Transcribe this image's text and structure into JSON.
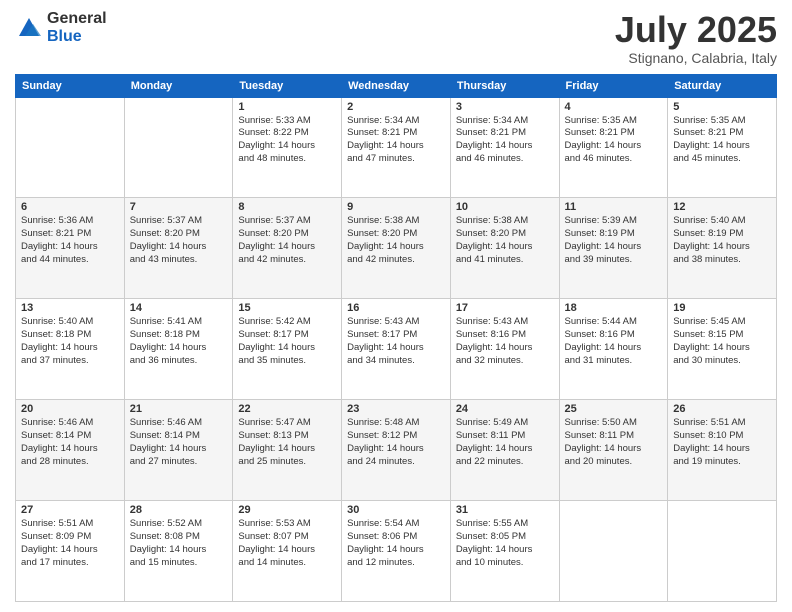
{
  "header": {
    "logo": {
      "general": "General",
      "blue": "Blue"
    },
    "title": "July 2025",
    "location": "Stignano, Calabria, Italy"
  },
  "weekdays": [
    "Sunday",
    "Monday",
    "Tuesday",
    "Wednesday",
    "Thursday",
    "Friday",
    "Saturday"
  ],
  "weeks": [
    [
      {
        "day": "",
        "sunrise": "",
        "sunset": "",
        "daylight": ""
      },
      {
        "day": "",
        "sunrise": "",
        "sunset": "",
        "daylight": ""
      },
      {
        "day": "1",
        "sunrise": "Sunrise: 5:33 AM",
        "sunset": "Sunset: 8:22 PM",
        "daylight": "Daylight: 14 hours and 48 minutes."
      },
      {
        "day": "2",
        "sunrise": "Sunrise: 5:34 AM",
        "sunset": "Sunset: 8:21 PM",
        "daylight": "Daylight: 14 hours and 47 minutes."
      },
      {
        "day": "3",
        "sunrise": "Sunrise: 5:34 AM",
        "sunset": "Sunset: 8:21 PM",
        "daylight": "Daylight: 14 hours and 46 minutes."
      },
      {
        "day": "4",
        "sunrise": "Sunrise: 5:35 AM",
        "sunset": "Sunset: 8:21 PM",
        "daylight": "Daylight: 14 hours and 46 minutes."
      },
      {
        "day": "5",
        "sunrise": "Sunrise: 5:35 AM",
        "sunset": "Sunset: 8:21 PM",
        "daylight": "Daylight: 14 hours and 45 minutes."
      }
    ],
    [
      {
        "day": "6",
        "sunrise": "Sunrise: 5:36 AM",
        "sunset": "Sunset: 8:21 PM",
        "daylight": "Daylight: 14 hours and 44 minutes."
      },
      {
        "day": "7",
        "sunrise": "Sunrise: 5:37 AM",
        "sunset": "Sunset: 8:20 PM",
        "daylight": "Daylight: 14 hours and 43 minutes."
      },
      {
        "day": "8",
        "sunrise": "Sunrise: 5:37 AM",
        "sunset": "Sunset: 8:20 PM",
        "daylight": "Daylight: 14 hours and 42 minutes."
      },
      {
        "day": "9",
        "sunrise": "Sunrise: 5:38 AM",
        "sunset": "Sunset: 8:20 PM",
        "daylight": "Daylight: 14 hours and 42 minutes."
      },
      {
        "day": "10",
        "sunrise": "Sunrise: 5:38 AM",
        "sunset": "Sunset: 8:20 PM",
        "daylight": "Daylight: 14 hours and 41 minutes."
      },
      {
        "day": "11",
        "sunrise": "Sunrise: 5:39 AM",
        "sunset": "Sunset: 8:19 PM",
        "daylight": "Daylight: 14 hours and 39 minutes."
      },
      {
        "day": "12",
        "sunrise": "Sunrise: 5:40 AM",
        "sunset": "Sunset: 8:19 PM",
        "daylight": "Daylight: 14 hours and 38 minutes."
      }
    ],
    [
      {
        "day": "13",
        "sunrise": "Sunrise: 5:40 AM",
        "sunset": "Sunset: 8:18 PM",
        "daylight": "Daylight: 14 hours and 37 minutes."
      },
      {
        "day": "14",
        "sunrise": "Sunrise: 5:41 AM",
        "sunset": "Sunset: 8:18 PM",
        "daylight": "Daylight: 14 hours and 36 minutes."
      },
      {
        "day": "15",
        "sunrise": "Sunrise: 5:42 AM",
        "sunset": "Sunset: 8:17 PM",
        "daylight": "Daylight: 14 hours and 35 minutes."
      },
      {
        "day": "16",
        "sunrise": "Sunrise: 5:43 AM",
        "sunset": "Sunset: 8:17 PM",
        "daylight": "Daylight: 14 hours and 34 minutes."
      },
      {
        "day": "17",
        "sunrise": "Sunrise: 5:43 AM",
        "sunset": "Sunset: 8:16 PM",
        "daylight": "Daylight: 14 hours and 32 minutes."
      },
      {
        "day": "18",
        "sunrise": "Sunrise: 5:44 AM",
        "sunset": "Sunset: 8:16 PM",
        "daylight": "Daylight: 14 hours and 31 minutes."
      },
      {
        "day": "19",
        "sunrise": "Sunrise: 5:45 AM",
        "sunset": "Sunset: 8:15 PM",
        "daylight": "Daylight: 14 hours and 30 minutes."
      }
    ],
    [
      {
        "day": "20",
        "sunrise": "Sunrise: 5:46 AM",
        "sunset": "Sunset: 8:14 PM",
        "daylight": "Daylight: 14 hours and 28 minutes."
      },
      {
        "day": "21",
        "sunrise": "Sunrise: 5:46 AM",
        "sunset": "Sunset: 8:14 PM",
        "daylight": "Daylight: 14 hours and 27 minutes."
      },
      {
        "day": "22",
        "sunrise": "Sunrise: 5:47 AM",
        "sunset": "Sunset: 8:13 PM",
        "daylight": "Daylight: 14 hours and 25 minutes."
      },
      {
        "day": "23",
        "sunrise": "Sunrise: 5:48 AM",
        "sunset": "Sunset: 8:12 PM",
        "daylight": "Daylight: 14 hours and 24 minutes."
      },
      {
        "day": "24",
        "sunrise": "Sunrise: 5:49 AM",
        "sunset": "Sunset: 8:11 PM",
        "daylight": "Daylight: 14 hours and 22 minutes."
      },
      {
        "day": "25",
        "sunrise": "Sunrise: 5:50 AM",
        "sunset": "Sunset: 8:11 PM",
        "daylight": "Daylight: 14 hours and 20 minutes."
      },
      {
        "day": "26",
        "sunrise": "Sunrise: 5:51 AM",
        "sunset": "Sunset: 8:10 PM",
        "daylight": "Daylight: 14 hours and 19 minutes."
      }
    ],
    [
      {
        "day": "27",
        "sunrise": "Sunrise: 5:51 AM",
        "sunset": "Sunset: 8:09 PM",
        "daylight": "Daylight: 14 hours and 17 minutes."
      },
      {
        "day": "28",
        "sunrise": "Sunrise: 5:52 AM",
        "sunset": "Sunset: 8:08 PM",
        "daylight": "Daylight: 14 hours and 15 minutes."
      },
      {
        "day": "29",
        "sunrise": "Sunrise: 5:53 AM",
        "sunset": "Sunset: 8:07 PM",
        "daylight": "Daylight: 14 hours and 14 minutes."
      },
      {
        "day": "30",
        "sunrise": "Sunrise: 5:54 AM",
        "sunset": "Sunset: 8:06 PM",
        "daylight": "Daylight: 14 hours and 12 minutes."
      },
      {
        "day": "31",
        "sunrise": "Sunrise: 5:55 AM",
        "sunset": "Sunset: 8:05 PM",
        "daylight": "Daylight: 14 hours and 10 minutes."
      },
      {
        "day": "",
        "sunrise": "",
        "sunset": "",
        "daylight": ""
      },
      {
        "day": "",
        "sunrise": "",
        "sunset": "",
        "daylight": ""
      }
    ]
  ]
}
